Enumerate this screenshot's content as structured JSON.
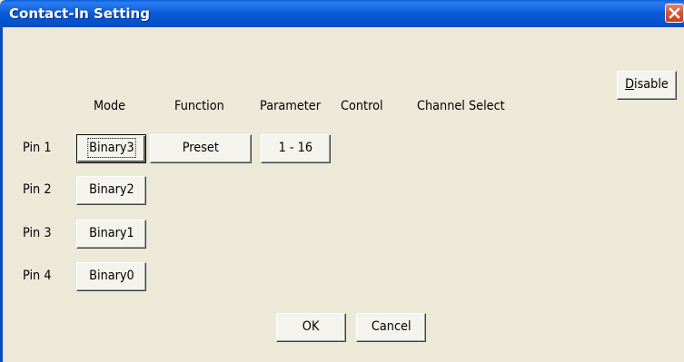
{
  "window": {
    "title": "Contact-In Setting"
  },
  "headers": {
    "mode": "Mode",
    "function": "Function",
    "parameter": "Parameter",
    "control": "Control",
    "channel_select": "Channel Select"
  },
  "disable_button": {
    "label_first": "D",
    "label_rest": "isable"
  },
  "pins": [
    {
      "label": "Pin 1",
      "mode": "Binary3",
      "function": "Preset",
      "parameter": "1 - 16"
    },
    {
      "label": "Pin 2",
      "mode": "Binary2"
    },
    {
      "label": "Pin 3",
      "mode": "Binary1"
    },
    {
      "label": "Pin 4",
      "mode": "Binary0"
    }
  ],
  "footer": {
    "ok_label": "OK",
    "cancel_label": "Cancel"
  },
  "icons": {
    "close": "close-x-icon"
  }
}
